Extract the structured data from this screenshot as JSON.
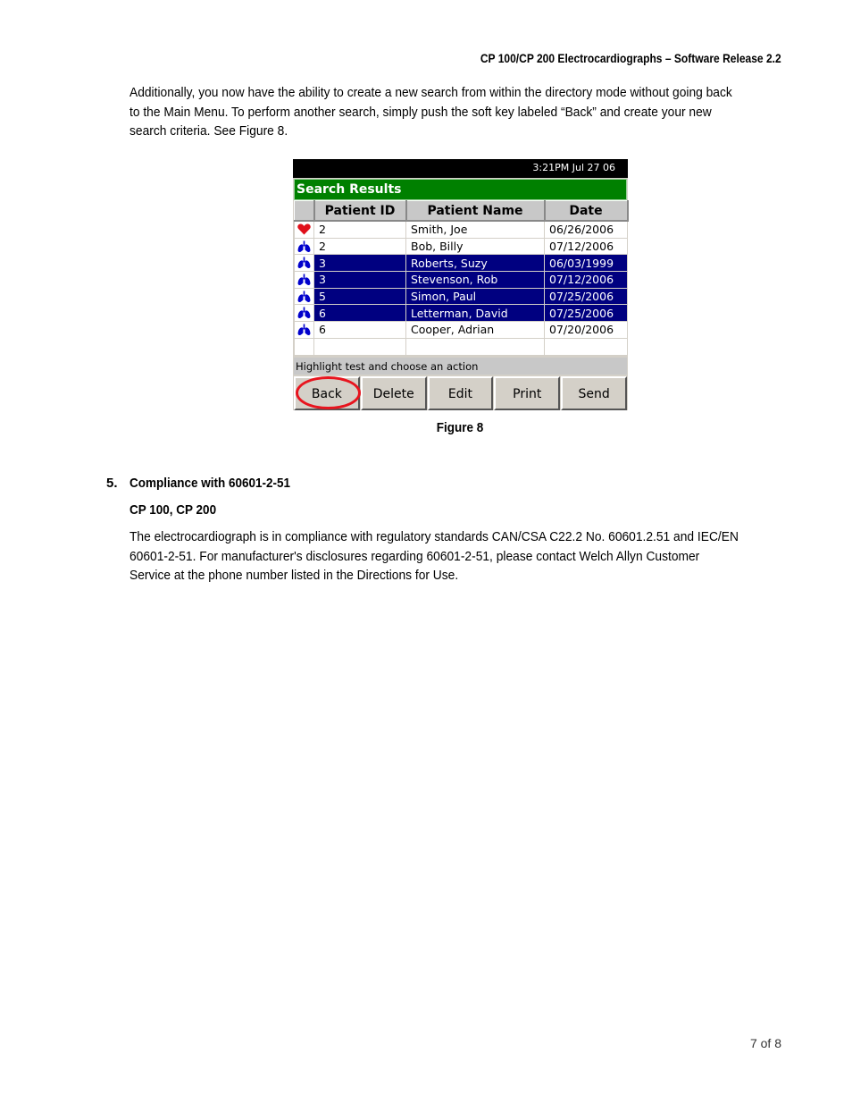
{
  "header": "CP 100/CP 200 Electrocardiographs – Software Release 2.2",
  "intro": "Additionally, you now have the ability to create a new search from within the directory mode without going back to the Main Menu. To perform another search, simply push the soft key labeled “Back” and create your new search criteria. See Figure 8.",
  "screen": {
    "status_time": "3:21PM Jul 27 06",
    "results_title": "Search Results",
    "columns": [
      "Patient ID",
      "Patient Name",
      "Date"
    ],
    "rows": [
      {
        "icon": "heart-icon",
        "id": "2",
        "name": "Smith, Joe",
        "date": "06/26/2006",
        "selected": false
      },
      {
        "icon": "lungs-icon",
        "id": "2",
        "name": "Bob, Billy",
        "date": "07/12/2006",
        "selected": false
      },
      {
        "icon": "lungs-icon",
        "id": "3",
        "name": "Roberts, Suzy",
        "date": "06/03/1999",
        "selected": true
      },
      {
        "icon": "lungs-icon",
        "id": "3",
        "name": "Stevenson, Rob",
        "date": "07/12/2006",
        "selected": true
      },
      {
        "icon": "lungs-icon",
        "id": "5",
        "name": "Simon, Paul",
        "date": "07/25/2006",
        "selected": true
      },
      {
        "icon": "lungs-icon",
        "id": "6",
        "name": "Letterman, David",
        "date": "07/25/2006",
        "selected": true
      },
      {
        "icon": "lungs-icon",
        "id": "6",
        "name": "Cooper, Adrian",
        "date": "07/20/2006",
        "selected": false
      }
    ],
    "hint": "Highlight test and choose an action",
    "softkeys": [
      "Back",
      "Delete",
      "Edit",
      "Print",
      "Send"
    ],
    "highlight_color": "#000080",
    "header_color": "#008000",
    "circle_color": "#e8141e"
  },
  "figure_caption": "Figure 8",
  "section": {
    "number": "5.",
    "title": "Compliance with 60601-2-51",
    "subtitle": "CP 100, CP 200",
    "body": "The electrocardiograph is in compliance with regulatory standards CAN/CSA C22.2 No. 60601.2.51 and IEC/EN 60601-2-51. For manufacturer's disclosures regarding 60601-2-51, please contact Welch Allyn Customer Service at the phone number listed in the Directions for Use."
  },
  "footer": "7 of 8"
}
